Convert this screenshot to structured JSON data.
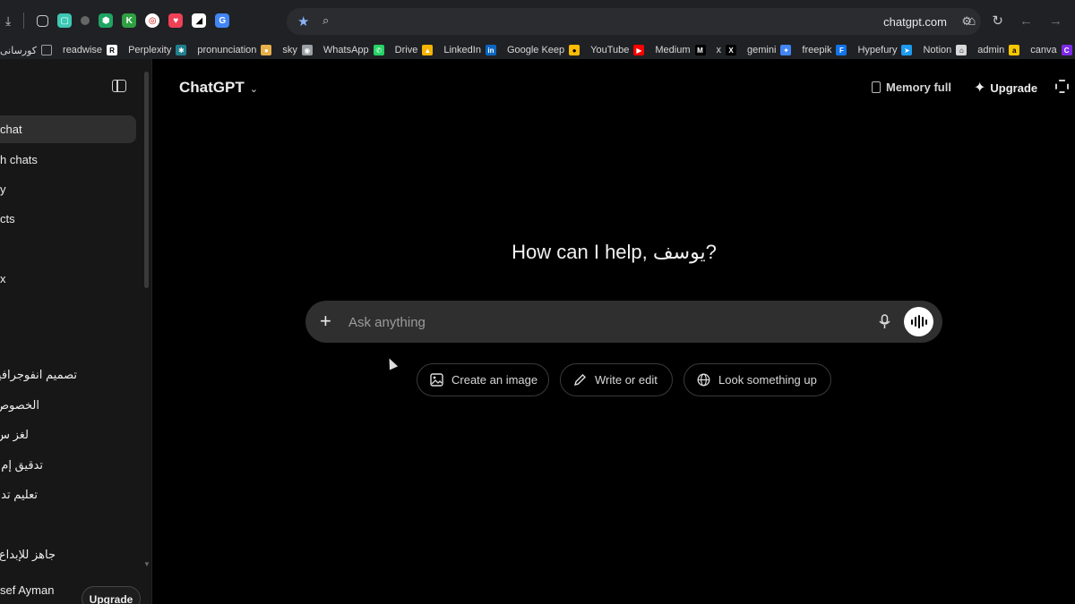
{
  "browser": {
    "url": "chatgpt.com",
    "bookmarks": [
      {
        "label": "کورسانی",
        "icon": "folder-icon",
        "color": "#9aa0a6"
      },
      {
        "label": "readwise",
        "icon": "readwise-icon",
        "color": "#ffffff",
        "glyph": "R"
      },
      {
        "label": "Perplexity",
        "icon": "perplexity-icon",
        "color": "#20808d",
        "glyph": "✱"
      },
      {
        "label": "pronunciation",
        "icon": "pronunciation-icon",
        "color": "#e8b04a",
        "glyph": "●"
      },
      {
        "label": "sky",
        "icon": "globe-icon",
        "color": "#9aa0a6",
        "glyph": "◉"
      },
      {
        "label": "WhatsApp",
        "icon": "whatsapp-icon",
        "color": "#25d366",
        "glyph": "✆"
      },
      {
        "label": "Drive",
        "icon": "drive-icon",
        "color": "#f4b400",
        "glyph": "▲"
      },
      {
        "label": "LinkedIn",
        "icon": "linkedin-icon",
        "color": "#0a66c2",
        "glyph": "in"
      },
      {
        "label": "Google Keep",
        "icon": "keep-icon",
        "color": "#fbbc04",
        "glyph": "●"
      },
      {
        "label": "YouTube",
        "icon": "youtube-icon",
        "color": "#ff0000",
        "glyph": "▶"
      },
      {
        "label": "Medium",
        "icon": "medium-icon",
        "color": "#000000",
        "glyph": "M"
      },
      {
        "label": "x",
        "icon": "x-icon",
        "color": "#000000",
        "glyph": "X"
      },
      {
        "label": "gemini",
        "icon": "gemini-icon",
        "color": "#4285f4",
        "glyph": "✦"
      },
      {
        "label": "freepik",
        "icon": "freepik-icon",
        "color": "#1273eb",
        "glyph": "F"
      },
      {
        "label": "Hypefury",
        "icon": "hypefury-icon",
        "color": "#1d9bf0",
        "glyph": "➤"
      },
      {
        "label": "Notion",
        "icon": "home-icon",
        "color": "#d8d8d8",
        "glyph": "⌂"
      },
      {
        "label": "admin",
        "icon": "admin-icon",
        "color": "#f6c700",
        "glyph": "a"
      },
      {
        "label": "canva",
        "icon": "canva-icon",
        "color": "#7d2ae8",
        "glyph": "C"
      }
    ]
  },
  "sidebar": {
    "items": [
      "chat",
      "h chats",
      "y",
      "cts",
      "x"
    ],
    "recent": [
      "تصميم انفوجرافيك",
      "الخصوص",
      "لغز س",
      "تدقيق إم",
      "تعليم تد",
      "جاهز للإبداع"
    ],
    "user_name": "sef Ayman",
    "upgrade_label": "Upgrade"
  },
  "header": {
    "model": "ChatGPT",
    "memory_label": "Memory full",
    "upgrade_label": "Upgrade"
  },
  "main": {
    "greeting": "How can I help, يوسف?",
    "composer_placeholder": "Ask anything",
    "chips": [
      "Create an image",
      "Write or edit",
      "Look something up"
    ]
  }
}
